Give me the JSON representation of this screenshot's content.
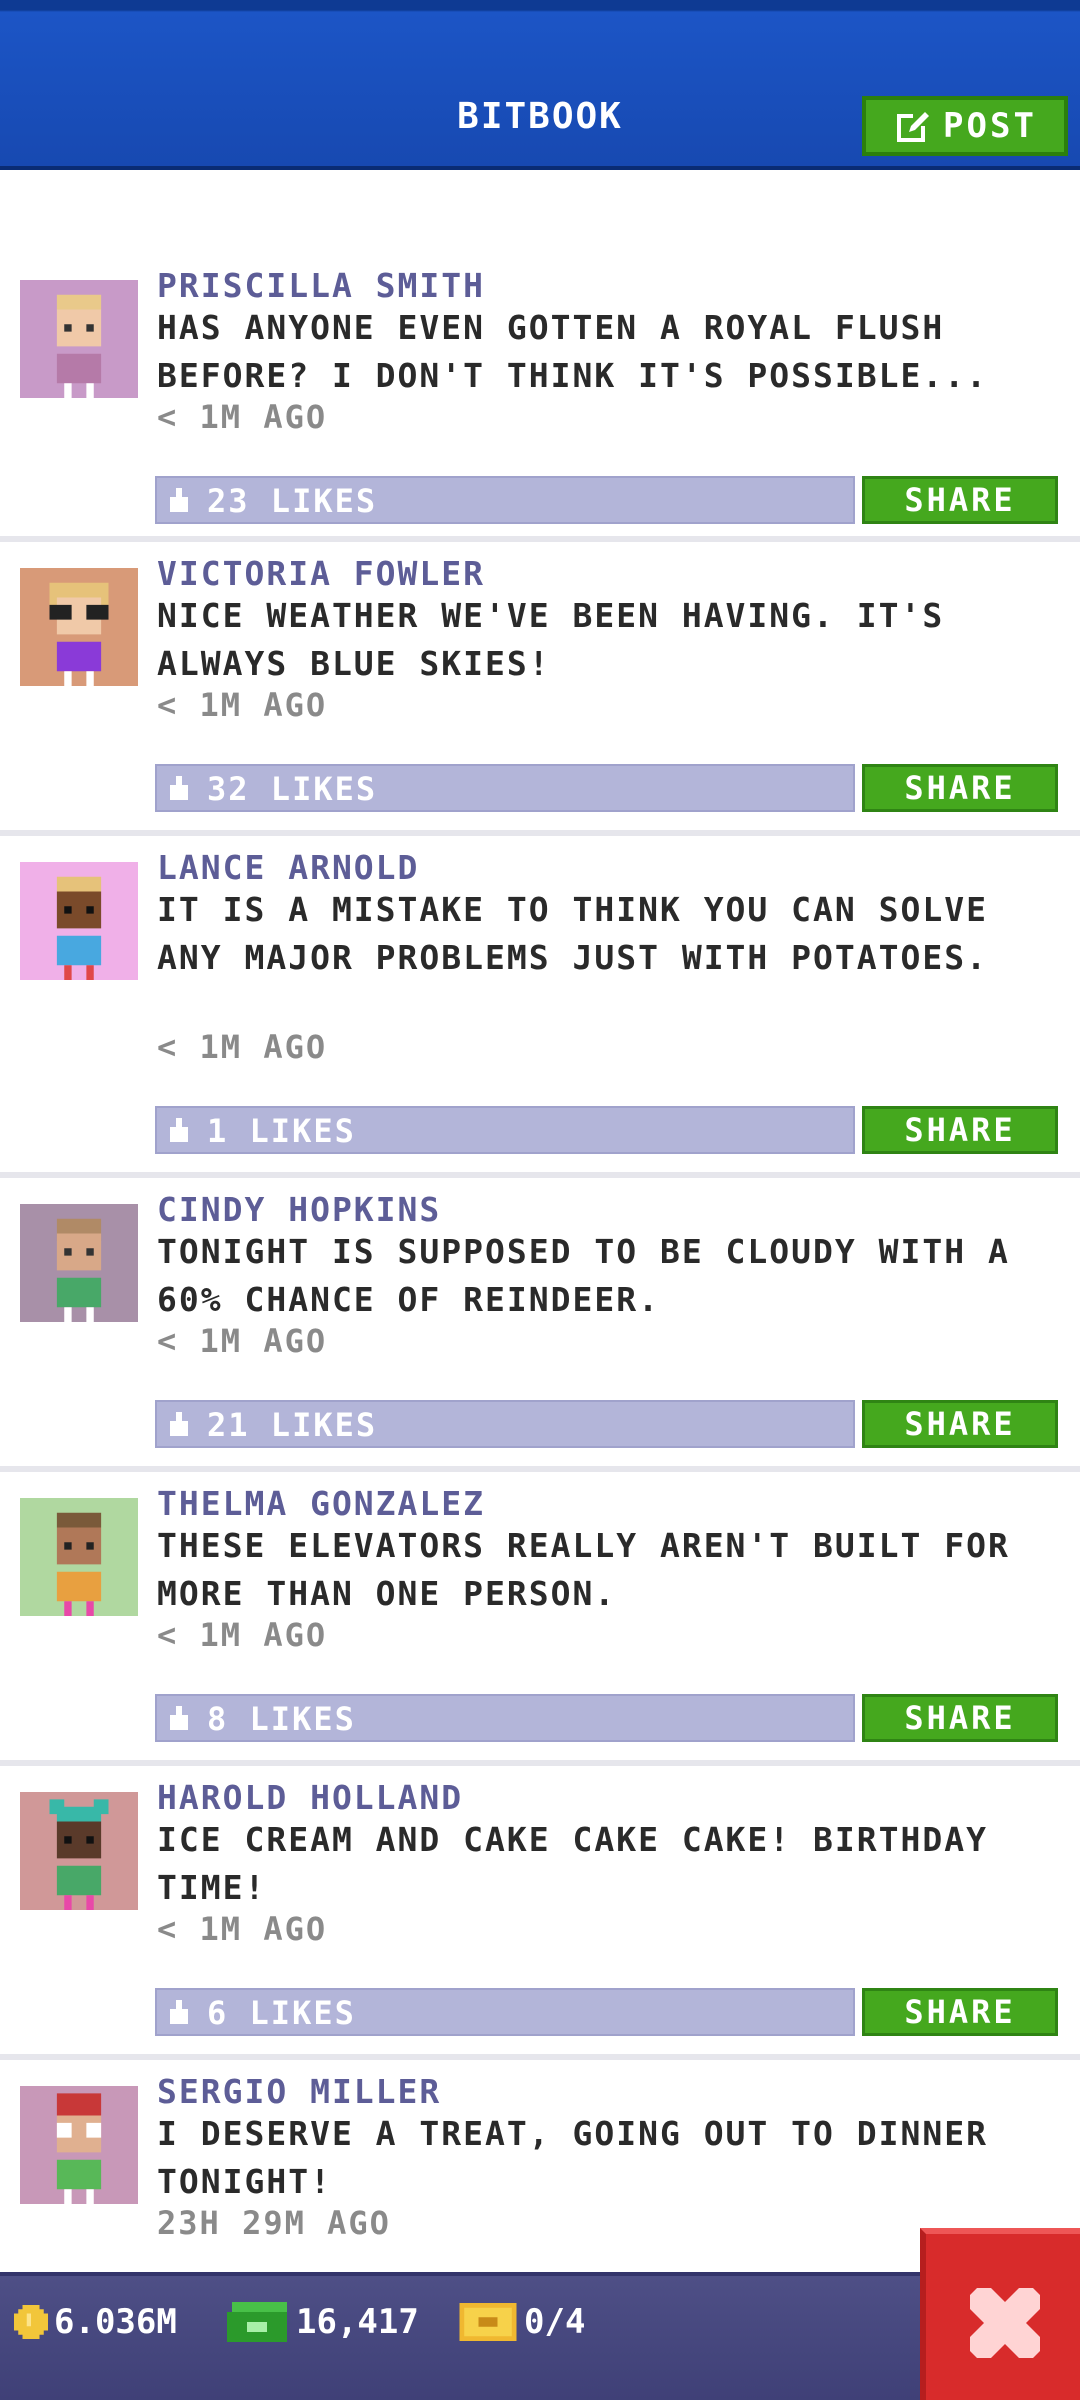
{
  "header": {
    "title": "BITBOOK",
    "post_label": "POST"
  },
  "posts": [
    {
      "author": "PRISCILLA SMITH",
      "text": "HAS ANYONE EVEN GOTTEN A ROYAL FLUSH BEFORE? I DON'T THINK IT'S POSSIBLE...",
      "time": "< 1M AGO",
      "likes": "23 LIKES",
      "share": "SHARE",
      "avatar_bg": "#c89ac8"
    },
    {
      "author": "VICTORIA FOWLER",
      "text": "NICE WEATHER WE'VE BEEN HAVING. IT'S ALWAYS BLUE SKIES!",
      "time": "< 1M AGO",
      "likes": "32 LIKES",
      "share": "SHARE",
      "avatar_bg": "#d89a78"
    },
    {
      "author": "LANCE ARNOLD",
      "text": "IT IS A MISTAKE TO THINK YOU CAN SOLVE ANY MAJOR PROBLEMS JUST WITH POTATOES.",
      "time": "< 1M AGO",
      "likes": "1 LIKES",
      "share": "SHARE",
      "avatar_bg": "#f0b0e8"
    },
    {
      "author": "CINDY HOPKINS",
      "text": "TONIGHT IS SUPPOSED TO BE CLOUDY WITH A 60% CHANCE OF REINDEER.",
      "time": "< 1M AGO",
      "likes": "21 LIKES",
      "share": "SHARE",
      "avatar_bg": "#a890a8"
    },
    {
      "author": "THELMA GONZALEZ",
      "text": "THESE ELEVATORS REALLY AREN'T BUILT FOR MORE THAN ONE PERSON.",
      "time": "< 1M AGO",
      "likes": "8 LIKES",
      "share": "SHARE",
      "avatar_bg": "#b0d8a0"
    },
    {
      "author": "HAROLD HOLLAND",
      "text": "ICE CREAM AND CAKE CAKE CAKE! BIRTHDAY TIME!",
      "time": "< 1M AGO",
      "likes": "6 LIKES",
      "share": "SHARE",
      "avatar_bg": "#d09898"
    },
    {
      "author": "SERGIO MILLER",
      "text": "I DESERVE A TREAT, GOING OUT TO DINNER TONIGHT!",
      "time": "23H 29M AGO",
      "avatar_bg": "#c898b8"
    }
  ],
  "footer": {
    "coins": "6.036M",
    "bux": "16,417",
    "tickets": "0/4"
  },
  "colors": {
    "header": "#1749b1",
    "accent_green": "#45a81e",
    "likes_bar": "#b3b5d9",
    "author": "#5d5d97",
    "close": "#d82b2b"
  }
}
